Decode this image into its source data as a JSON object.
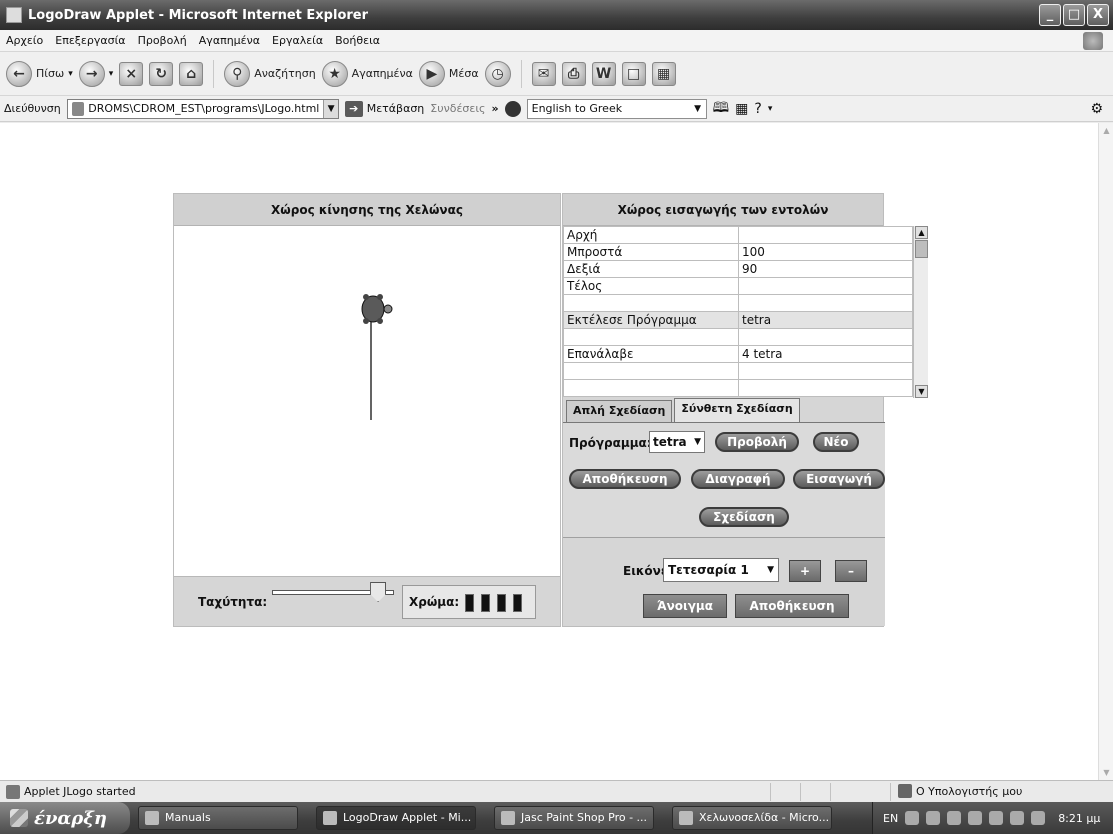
{
  "window": {
    "title": "LogoDraw Applet - Microsoft Internet Explorer",
    "controls": [
      "_",
      "□",
      "X"
    ]
  },
  "menu": [
    "Αρχείο",
    "Επεξεργασία",
    "Προβολή",
    "Αγαπημένα",
    "Εργαλεία",
    "Βοήθεια"
  ],
  "toolbar": {
    "back": "Πίσω",
    "search": "Αναζήτηση",
    "favorites": "Αγαπημένα",
    "media": "Μέσα"
  },
  "address": {
    "label": "Διεύθυνση",
    "value": "DROMS\\CDROM_EST\\programs\\JLogo.html",
    "go": "Μετάβαση",
    "links": "Συνδέσεις",
    "links_more": "»",
    "translate": "English to Greek"
  },
  "applet": {
    "left_title": "Χώρος κίνησης της Χελώνας",
    "right_title": "Χώρος εισαγωγής των εντολών",
    "speed_label": "Ταχύτητα:",
    "speed_level": 0.85,
    "color_label": "Χρώμα:",
    "commands": [
      {
        "cmd": "Αρχή",
        "arg": ""
      },
      {
        "cmd": "Μπροστά",
        "arg": "100"
      },
      {
        "cmd": "Δεξιά",
        "arg": "90"
      },
      {
        "cmd": "Τέλος",
        "arg": ""
      },
      {
        "cmd": "",
        "arg": ""
      },
      {
        "cmd": "Εκτέλεσε Πρόγραμμα",
        "arg": "tetra"
      },
      {
        "cmd": "",
        "arg": ""
      },
      {
        "cmd": "Επανάλαβε",
        "arg": "4 tetra"
      },
      {
        "cmd": "",
        "arg": ""
      },
      {
        "cmd": "",
        "arg": ""
      }
    ],
    "tabs": [
      "Απλή Σχεδίαση",
      "Σύνθετη Σχεδίαση"
    ],
    "program_label": "Πρόγραμμα:",
    "program_value": "tetra",
    "buttons": {
      "view": "Προβολή",
      "new": "Νέο",
      "save": "Αποθήκευση",
      "delete": "Διαγραφή",
      "import": "Εισαγωγή",
      "draw": "Σχεδίαση"
    },
    "images_label": "Εικόνες:",
    "images_value": "Τετεσαρία 1",
    "plus": "+",
    "minus": "–",
    "open": "Άνοιγμα",
    "save_image": "Αποθήκευση"
  },
  "status": {
    "text": "Applet JLogo started",
    "zone": "Ο Υπολογιστής μου"
  },
  "taskbar": {
    "start": "έναρξη",
    "tasks": [
      "Manuals",
      "LogoDraw Applet - Mi...",
      "Jasc Paint Shop Pro - ...",
      "Χελωνοσελίδα - Micro..."
    ],
    "lang": "EN",
    "clock": "8:21 μμ"
  }
}
